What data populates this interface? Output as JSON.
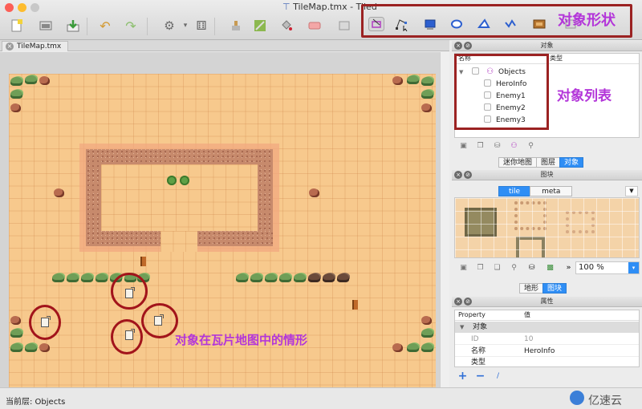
{
  "window": {
    "title": "TileMap.tmx - Tiled"
  },
  "toolbar": {
    "left_icons": [
      "new-file-icon",
      "open-file-icon",
      "save-icon",
      "undo-icon",
      "redo-icon",
      "stamp-icon",
      "dice-icon",
      "stamp-brush-icon",
      "terrain-brush-icon",
      "bucket-fill-icon",
      "eraser-icon",
      "rect-select-icon"
    ],
    "shape_icons": [
      "select-objects-icon",
      "edit-polygons-icon",
      "insert-rectangle-icon",
      "insert-ellipse-icon",
      "insert-polygon-icon",
      "insert-polyline-icon",
      "insert-tile-icon"
    ],
    "shapes_annotation": "对象形状"
  },
  "document_tab": {
    "label": "TileMap.tmx"
  },
  "map": {
    "annotation": "对象在瓦片地图中的情形"
  },
  "objects_panel": {
    "title": "对象",
    "col_name": "名称",
    "col_type": "类型",
    "layer_name": "Objects",
    "items": [
      "HeroInfo",
      "Enemy1",
      "Enemy2",
      "Enemy3"
    ],
    "annotation": "对象列表",
    "tabs": [
      "迷你地图",
      "图层",
      "对象"
    ],
    "active_tab": "对象"
  },
  "tileset_panel": {
    "title": "图块",
    "tabs": [
      "tile",
      "meta"
    ],
    "zoom": "100 %",
    "bottom_tabs": [
      "地形",
      "图块"
    ],
    "active_bottom_tab": "图块"
  },
  "properties_panel": {
    "title": "属性",
    "col_property": "Property",
    "col_value": "值",
    "group": "对象",
    "rows": [
      {
        "key": "ID",
        "value": "10"
      },
      {
        "key": "名称",
        "value": "HeroInfo"
      },
      {
        "key": "类型",
        "value": ""
      }
    ]
  },
  "status": {
    "current_layer": "当前层: Objects"
  },
  "watermark": {
    "text": "亿速云"
  }
}
